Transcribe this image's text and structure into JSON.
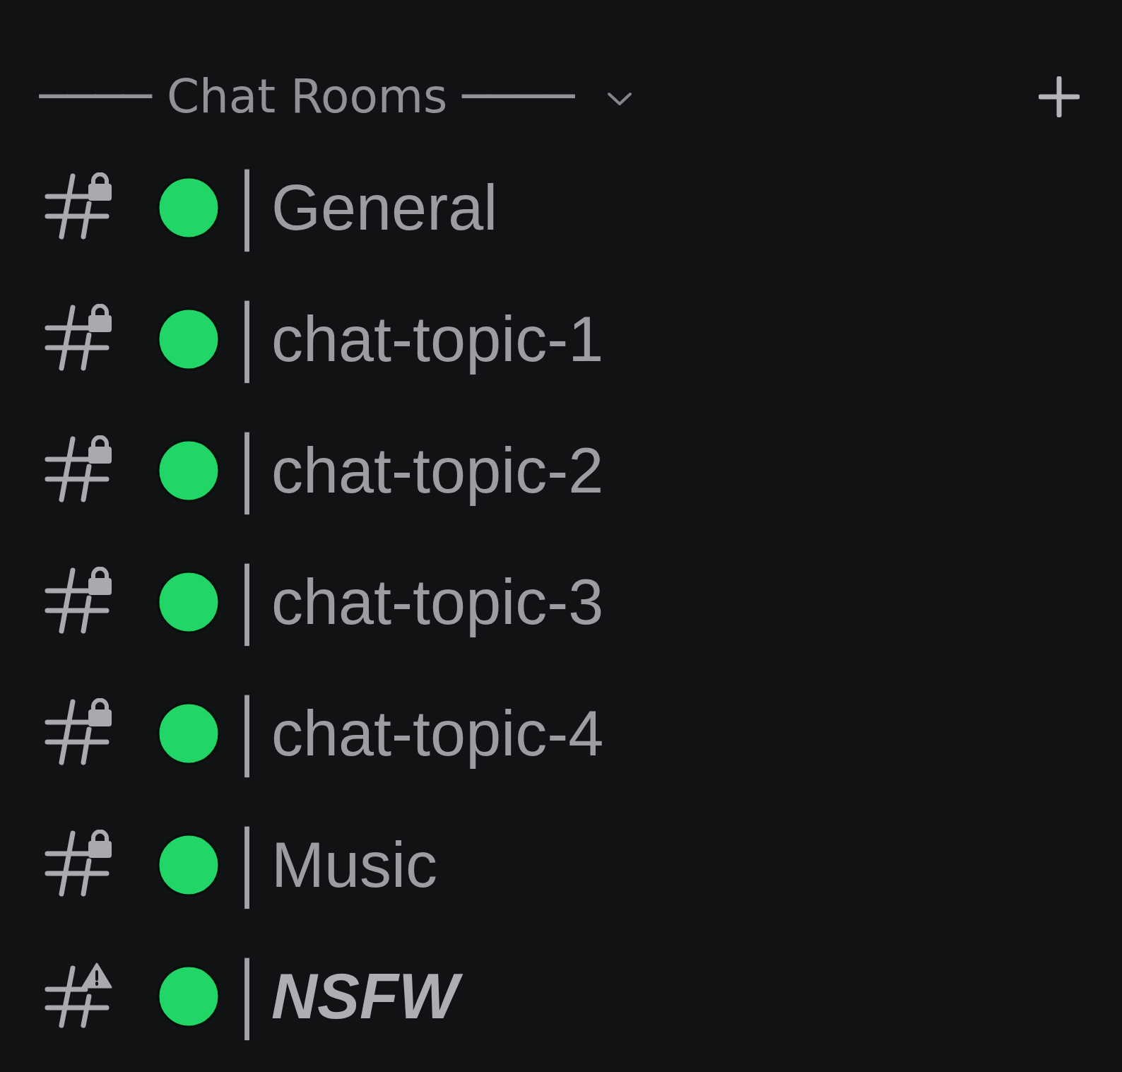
{
  "category": {
    "name": "──── Chat Rooms ────",
    "expanded": true
  },
  "channels": [
    {
      "kind": "lock",
      "separator": "│",
      "name": "General",
      "emphasis": false
    },
    {
      "kind": "lock",
      "separator": "│",
      "name": "chat-topic-1",
      "emphasis": false
    },
    {
      "kind": "lock",
      "separator": "│",
      "name": "chat-topic-2",
      "emphasis": false
    },
    {
      "kind": "lock",
      "separator": "│",
      "name": "chat-topic-3",
      "emphasis": false
    },
    {
      "kind": "lock",
      "separator": "│",
      "name": "chat-topic-4",
      "emphasis": false
    },
    {
      "kind": "lock",
      "separator": "│",
      "name": "Music",
      "emphasis": false
    },
    {
      "kind": "warning",
      "separator": "│",
      "name": "NSFW",
      "emphasis": true
    }
  ]
}
